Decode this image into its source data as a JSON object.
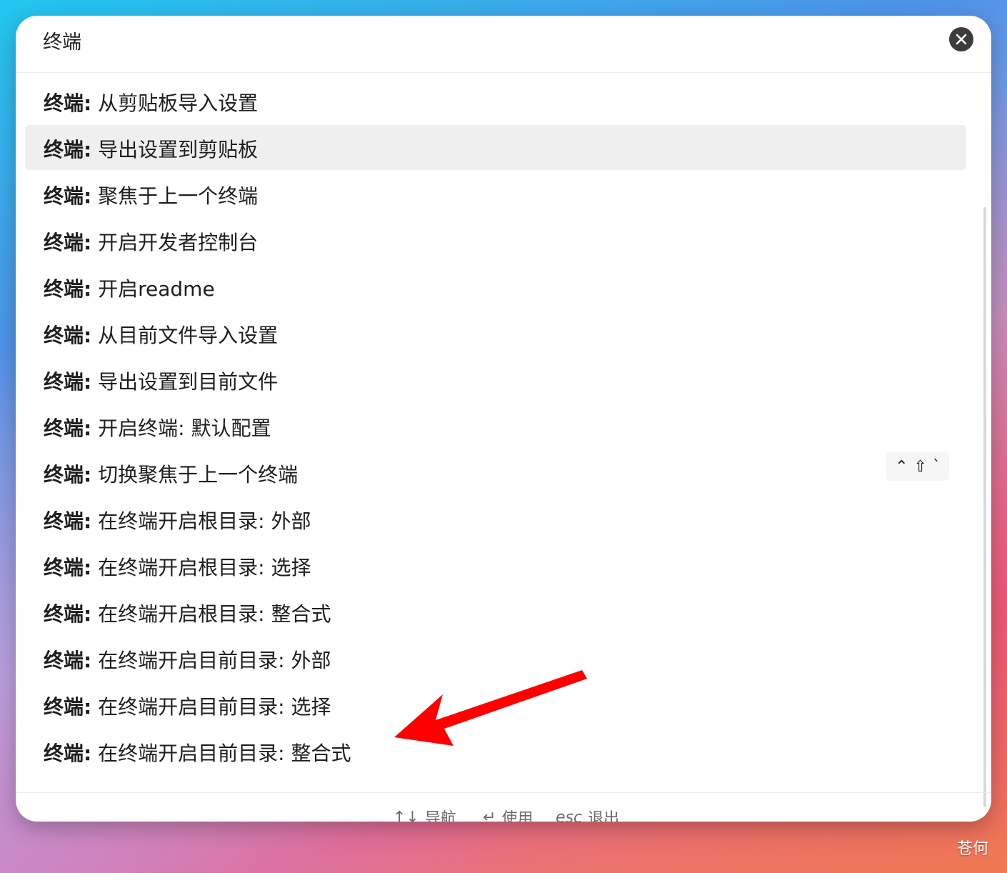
{
  "search": {
    "value": "终端"
  },
  "items": [
    {
      "prefix": "终端:",
      "label": "从剪贴板导入设置"
    },
    {
      "prefix": "终端:",
      "label": "导出设置到剪贴板"
    },
    {
      "prefix": "终端:",
      "label": "聚焦于上一个终端"
    },
    {
      "prefix": "终端:",
      "label": "开启开发者控制台"
    },
    {
      "prefix": "终端:",
      "label": "开启readme"
    },
    {
      "prefix": "终端:",
      "label": "从目前文件导入设置"
    },
    {
      "prefix": "终端:",
      "label": "导出设置到目前文件"
    },
    {
      "prefix": "终端:",
      "label": "开启终端: 默认配置"
    },
    {
      "prefix": "终端:",
      "label": "切换聚焦于上一个终端",
      "shortcut": [
        "⌃",
        "⇧",
        "`"
      ]
    },
    {
      "prefix": "终端:",
      "label": "在终端开启根目录: 外部"
    },
    {
      "prefix": "终端:",
      "label": "在终端开启根目录: 选择"
    },
    {
      "prefix": "终端:",
      "label": "在终端开启根目录: 整合式"
    },
    {
      "prefix": "终端:",
      "label": "在终端开启目前目录: 外部"
    },
    {
      "prefix": "终端:",
      "label": "在终端开启目前目录: 选择"
    },
    {
      "prefix": "终端:",
      "label": "在终端开启目前目录: 整合式"
    }
  ],
  "selected_index": 1,
  "footer": {
    "nav_keys": "↑↓",
    "nav_label": "导航",
    "use_key": "↵",
    "use_label": "使用",
    "esc_key": "esc",
    "esc_label": "退出"
  },
  "watermark": "苍何",
  "colors": {
    "selected_bg": "#efefef",
    "annotation_arrow": "#ff0000"
  }
}
